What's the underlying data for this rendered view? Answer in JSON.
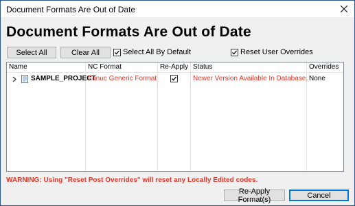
{
  "window": {
    "title": "Document Formats Are Out of Date"
  },
  "heading": "Document Formats Are Out of Date",
  "toolbar": {
    "select_all": "Select All",
    "clear_all": "Clear All",
    "select_all_by_default": {
      "label": "Select All By Default",
      "checked": true
    },
    "reset_user_overrides": {
      "label": "Reset User Overrides",
      "checked": true
    }
  },
  "grid": {
    "columns": [
      "Name",
      "NC Format",
      "Re-Apply",
      "Status",
      "Overrides"
    ],
    "rows": [
      {
        "name": "SAMPLE_PROJECT",
        "nc_format": "Fanuc Generic Format",
        "reapply": true,
        "status": "Newer Version Available In Database.",
        "overrides": "None"
      }
    ]
  },
  "warning": "WARNING: Using \"Reset Post Overrides\" will reset any Locally Edited codes.",
  "footer": {
    "reapply_button": "Re-Apply Format(s)",
    "cancel_button": "Cancel"
  },
  "colors": {
    "warning": "#e0392b",
    "accent": "#0078d7"
  }
}
